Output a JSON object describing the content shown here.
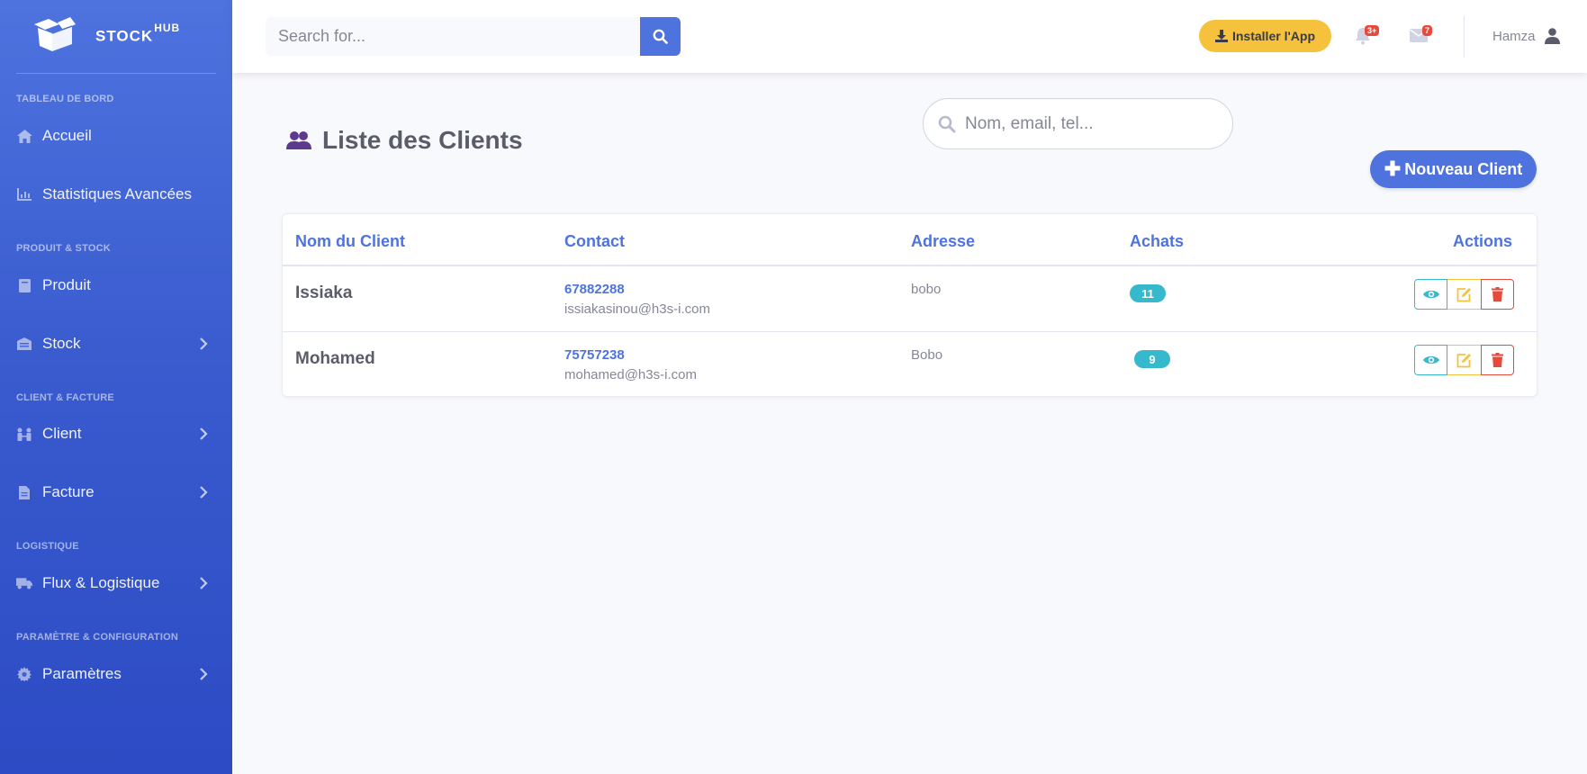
{
  "brand": {
    "name": "STOCK",
    "sup": "HUB"
  },
  "sidebar": {
    "headings": [
      "TABLEAU DE BORD",
      "PRODUIT & STOCK",
      "CLIENT & FACTURE",
      "LOGISTIQUE",
      "PARAMÈTRE & CONFIGURATION"
    ],
    "items": [
      {
        "label": "Accueil",
        "icon": "home-icon"
      },
      {
        "label": "Statistiques Avancées",
        "icon": "chart-icon"
      },
      {
        "label": "Produit",
        "icon": "book-icon"
      },
      {
        "label": "Stock",
        "icon": "warehouse-icon"
      },
      {
        "label": "Client",
        "icon": "people-icon"
      },
      {
        "label": "Facture",
        "icon": "file-icon"
      },
      {
        "label": "Flux & Logistique",
        "icon": "truck-icon"
      },
      {
        "label": "Paramètres",
        "icon": "gear-icon"
      }
    ]
  },
  "topbar": {
    "search_placeholder": "Search for...",
    "install_label": "Installer l'App",
    "alerts_count": "3+",
    "messages_count": "7",
    "user_name": "Hamza"
  },
  "page": {
    "title": "Liste des Clients",
    "search_placeholder": "Nom, email, tel...",
    "new_button": "Nouveau Client"
  },
  "table": {
    "headers": [
      "Nom du Client",
      "Contact",
      "Adresse",
      "Achats",
      "Actions"
    ],
    "rows": [
      {
        "name": "Issiaka",
        "phone": "67882288",
        "email": "issiakasinou@h3s-i.com",
        "address": "bobo",
        "purchases": "11"
      },
      {
        "name": "Mohamed",
        "phone": "75757238",
        "email": "mohamed@h3s-i.com",
        "address": "Bobo",
        "purchases": "9"
      }
    ]
  },
  "colors": {
    "primary": "#4e73df",
    "info": "#36b9cc",
    "warning": "#f6c23e",
    "danger": "#e74a3b"
  }
}
